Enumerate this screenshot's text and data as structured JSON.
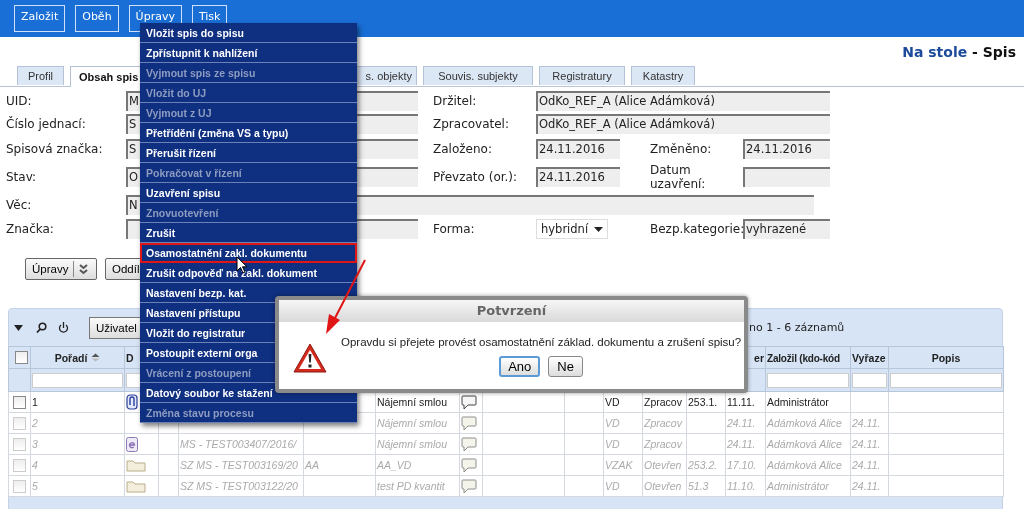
{
  "toolbar": {
    "buttons": [
      {
        "label": "Založit"
      },
      {
        "label": "Oběh"
      },
      {
        "label": "Úpravy"
      },
      {
        "label": "Tisk"
      }
    ]
  },
  "header": {
    "section": "Na stole",
    "separator": "-",
    "page": "Spis"
  },
  "tabs": [
    {
      "label": "Profil",
      "selected": false
    },
    {
      "label": "Obsah spis",
      "selected": true
    },
    {
      "label": "s. objekty",
      "selected": false
    },
    {
      "label": "Souvis. subjekty",
      "selected": false
    },
    {
      "label": "Registratury",
      "selected": false
    },
    {
      "label": "Katastry",
      "selected": false
    }
  ],
  "form": {
    "rows": [
      {
        "left": {
          "label": "UID:",
          "value": "M"
        },
        "mid": {
          "label": "Držitel:",
          "value": "OdKo_REF_A (Alice Adámková)"
        }
      },
      {
        "left": {
          "label": "Číslo jednací:",
          "value": "S"
        },
        "mid": {
          "label": "Zpracovatel:",
          "value": "OdKo_REF_A (Alice Adámková)"
        }
      },
      {
        "left": {
          "label": "Spisová značka:",
          "value": "S"
        },
        "mid": {
          "label": "Založeno:",
          "value": "24.11.2016"
        },
        "right": {
          "label": "Změněno:",
          "value": "24.11.2016"
        }
      },
      {
        "left": {
          "label": "Stav:",
          "value": "O"
        },
        "mid": {
          "label": "Převzato (or.):",
          "value": "24.11.2016"
        },
        "right": {
          "label": "Datum uzavření:"
        }
      },
      {
        "left": {
          "label": "Věc:",
          "value": "N",
          "wide": true
        }
      },
      {
        "left": {
          "label": "Značka:"
        },
        "mid": {
          "label": "Forma:",
          "value": "hybridní",
          "kind": "select"
        },
        "right": {
          "label": "Bezp.kategorie:",
          "value": "vyhrazené"
        }
      }
    ]
  },
  "actions": [
    {
      "label": "Úpravy",
      "kind": "split"
    },
    {
      "label": "Oddíl",
      "kind": "plain"
    }
  ],
  "grid": {
    "toolbar_button": "Uživatel",
    "paging": "no 1 - 6 záznamů",
    "columns": [
      {
        "kind": "checkbox",
        "checked": false
      },
      {
        "label": "Pořadí",
        "sorted": true,
        "filter": true
      },
      {
        "label": "D",
        "filter": true
      },
      {
        "label": "er"
      },
      {
        "label": "Založil (kdo-kód",
        "filter": true
      },
      {
        "label": "Vyřaze",
        "filter": true
      },
      {
        "label": "Popis",
        "filter": true
      }
    ],
    "rows": [
      {
        "checked": false,
        "disabled": false,
        "order": "1",
        "kind": "paperclip",
        "subject": "Nájemní smlou",
        "type": "VD",
        "state": "Zpracov",
        "column_12": "253.1.",
        "date": "11.11.",
        "created_by": "Administrátor"
      },
      {
        "checked": false,
        "disabled": true,
        "order": "2",
        "subject": "Nájemní smlou",
        "type": "VD",
        "state": "Zpracov",
        "date": "24.11.",
        "created_by": "Adámková Alice",
        "column_16": "24.11."
      },
      {
        "checked": false,
        "disabled": true,
        "order": "3",
        "kind": "electronic",
        "ref": "MS - TEST003407/2016/",
        "subject": "Nájemní smlou",
        "type": "VD",
        "state": "Zpracov",
        "date": "24.11.",
        "created_by": "Adámková Alice",
        "column_16": "24.11."
      },
      {
        "checked": false,
        "disabled": true,
        "order": "4",
        "kind": "folder",
        "ref": "SZ MS - TEST003169/20",
        "column_6": "AA",
        "subject": "AA_VD",
        "type": "VZAK",
        "state": "Otevřen",
        "column_12": "253.2.",
        "date": "17.10.",
        "created_by": "Adámková Alice",
        "column_16": "24.11."
      },
      {
        "checked": false,
        "disabled": true,
        "order": "5",
        "kind": "folder",
        "ref": "SZ MS - TEST003122/20",
        "subject": "test PD kvantit",
        "type": "VD",
        "state": "Otevřen",
        "column_12": "51.3",
        "date": "11.10.",
        "created_by": "Administrátor",
        "column_16": "24.11."
      }
    ]
  },
  "menu": {
    "items": [
      {
        "label": "Vložit spis do spisu",
        "disabled": false,
        "selected": false
      },
      {
        "label": "Zpřístupnit k nahlížení",
        "disabled": false,
        "selected": false
      },
      {
        "label": "Vyjmout spis ze spisu",
        "disabled": true,
        "selected": false
      },
      {
        "label": "Vložit do UJ",
        "disabled": true,
        "selected": false
      },
      {
        "label": "Vyjmout z UJ",
        "disabled": true,
        "selected": false
      },
      {
        "label": "Přetřídění (změna VS a typu)",
        "disabled": false,
        "selected": false
      },
      {
        "label": "Přerušit řízení",
        "disabled": false,
        "selected": false
      },
      {
        "label": "Pokračovat v řízení",
        "disabled": true,
        "selected": false
      },
      {
        "label": "Uzavření spisu",
        "disabled": false,
        "selected": false
      },
      {
        "label": "Znovuotevření",
        "disabled": true,
        "selected": false
      },
      {
        "label": "Zrušit",
        "disabled": false,
        "selected": false
      },
      {
        "label": "Osamostatnění zakl. dokumentu",
        "disabled": false,
        "selected": true
      },
      {
        "label": "Zrušit odpověď na zakl. dokument",
        "disabled": false,
        "selected": false
      },
      {
        "label": "Nastavení bezp. kat.",
        "disabled": false,
        "selected": false
      },
      {
        "label": "Nastavení přístupu",
        "disabled": false,
        "selected": false
      },
      {
        "label": "Vložit do registratur",
        "disabled": false,
        "selected": false
      },
      {
        "label": "Postoupit externí orga",
        "disabled": false,
        "selected": false
      },
      {
        "label": "Vrácení z postoupení",
        "disabled": true,
        "selected": false
      },
      {
        "label": "Datový soubor ke stažení",
        "disabled": false,
        "selected": false
      },
      {
        "label": "Změna stavu procesu",
        "disabled": true,
        "selected": false
      }
    ]
  },
  "dialog": {
    "title": "Potvrzení",
    "message": "Opravdu si přejete provést osamostatnění základ. dokumentu a zrušení spisu?",
    "buttons": [
      {
        "label": "Ano",
        "default": true
      },
      {
        "label": "Ne",
        "default": false
      }
    ]
  }
}
